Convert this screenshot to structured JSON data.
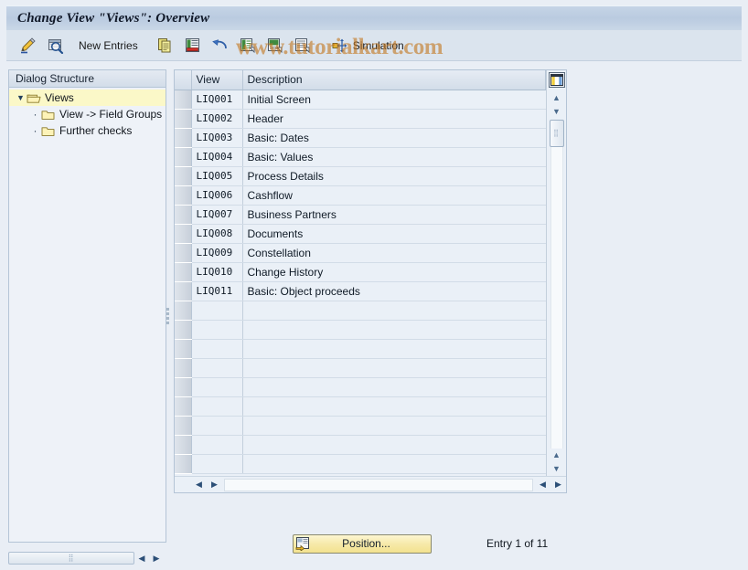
{
  "window": {
    "title": "Change View \"Views\": Overview"
  },
  "watermark": {
    "text": "www.tutorialkart.com",
    "color": "#c47820"
  },
  "toolbar": {
    "items": [
      {
        "name": "display-change-icon",
        "icon": "pencil-magnify",
        "label": ""
      },
      {
        "name": "details-icon",
        "icon": "magnify-table",
        "label": ""
      },
      {
        "name": "new-entries-button",
        "icon": "",
        "label": "New Entries"
      },
      {
        "name": "copy-as-icon",
        "icon": "copy",
        "label": ""
      },
      {
        "name": "delete-icon",
        "icon": "delete-row",
        "label": ""
      },
      {
        "name": "undo-icon",
        "icon": "undo",
        "label": ""
      },
      {
        "name": "select-all-icon",
        "icon": "select-all",
        "label": ""
      },
      {
        "name": "select-block-icon",
        "icon": "select-block",
        "label": ""
      },
      {
        "name": "deselect-all-icon",
        "icon": "deselect-all",
        "label": ""
      },
      {
        "name": "simulation-button",
        "icon": "simulation-arrows",
        "label": "Simulation"
      }
    ]
  },
  "sidebar": {
    "header": "Dialog Structure",
    "items": [
      {
        "label": "Views",
        "level": 0,
        "selected": true,
        "expanded": true
      },
      {
        "label": "View -> Field Groups",
        "level": 1,
        "selected": false
      },
      {
        "label": "Further checks",
        "level": 1,
        "selected": false
      }
    ]
  },
  "table": {
    "columns": [
      "View",
      "Description"
    ],
    "config_icon": "column-config-icon",
    "rows": [
      {
        "view": "LIQ001",
        "description": "Initial Screen"
      },
      {
        "view": "LIQ002",
        "description": "Header"
      },
      {
        "view": "LIQ003",
        "description": "Basic: Dates"
      },
      {
        "view": "LIQ004",
        "description": "Basic: Values"
      },
      {
        "view": "LIQ005",
        "description": "Process Details"
      },
      {
        "view": "LIQ006",
        "description": "Cashflow"
      },
      {
        "view": "LIQ007",
        "description": "Business Partners"
      },
      {
        "view": "LIQ008",
        "description": "Documents"
      },
      {
        "view": "LIQ009",
        "description": "Constellation"
      },
      {
        "view": "LIQ010",
        "description": "Change History"
      },
      {
        "view": "LIQ011",
        "description": "Basic: Object proceeds"
      },
      {
        "view": "",
        "description": ""
      },
      {
        "view": "",
        "description": ""
      },
      {
        "view": "",
        "description": ""
      },
      {
        "view": "",
        "description": ""
      },
      {
        "view": "",
        "description": ""
      },
      {
        "view": "",
        "description": ""
      },
      {
        "view": "",
        "description": ""
      },
      {
        "view": "",
        "description": ""
      },
      {
        "view": "",
        "description": ""
      }
    ]
  },
  "footer": {
    "position_button": "Position...",
    "entry_status": "Entry 1 of 11"
  }
}
